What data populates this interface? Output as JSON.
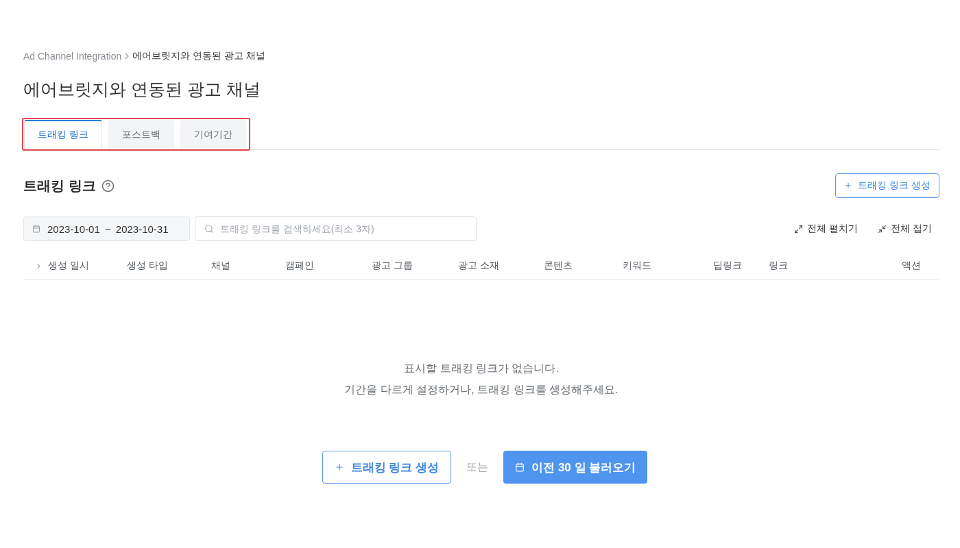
{
  "breadcrumb": [
    {
      "label": "Ad Channel Integration",
      "current": false
    },
    {
      "label": "에어브릿지와 연동된 광고 채널",
      "current": true
    }
  ],
  "page_title": "에어브릿지와 연동된 광고 채널",
  "tabs": {
    "highlighted": true,
    "items": [
      {
        "label": "트래킹 링크",
        "selected": true
      },
      {
        "label": "포스트백",
        "selected": false
      },
      {
        "label": "기여기간",
        "selected": false
      }
    ]
  },
  "section": {
    "title": "트래킹 링크",
    "create_button": "트래킹 링크 생성"
  },
  "filters": {
    "date_range": "2023-10-01 ~ 2023-10-31",
    "search": {
      "placeholder": "트래킹 링크를 검색하세요(최소 3자)"
    },
    "expand_all": "전체 펼치기",
    "collapse_all": "전체 접기"
  },
  "table": {
    "columns": [
      "생성 일시",
      "생성 타입",
      "채널",
      "캠페인",
      "광고 그룹",
      "광고 소재",
      "콘텐츠",
      "키워드",
      "딥링크",
      "링크",
      "액션"
    ],
    "empty_message": [
      "표시할 트래킹 링크가 없습니다.",
      "기간을 다르게 설정하거나, 트래킹 링크를 생성해주세요."
    ]
  },
  "empty_actions": {
    "create_button": "트래킹 링크 생성",
    "separator": "또는",
    "load_button": "이전 30 일 불러오기"
  }
}
